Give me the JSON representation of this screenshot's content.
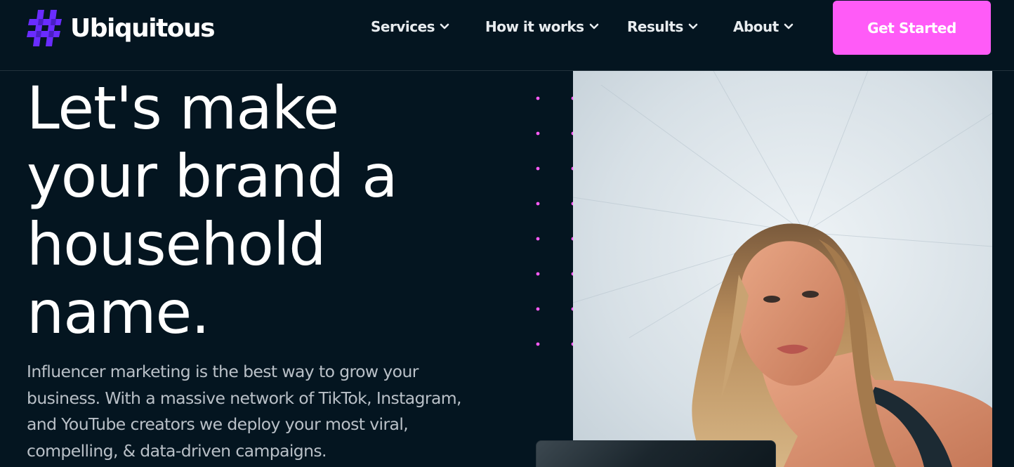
{
  "brand": {
    "name": "Ubiquitous",
    "logo_icon": "hash-icon",
    "accent": "#ff5bf7",
    "logo_color": "#6a2cff"
  },
  "nav": {
    "items": [
      {
        "label": "Services",
        "icon": "chevron-down-icon"
      },
      {
        "label": "How it works",
        "icon": "chevron-down-icon"
      },
      {
        "label": "Results",
        "icon": "chevron-down-icon"
      },
      {
        "label": "About",
        "icon": "chevron-down-icon"
      }
    ],
    "cta_label": "Get Started"
  },
  "hero": {
    "title_lines": [
      "Let's make",
      "your brand a",
      "household",
      "name."
    ],
    "subtitle": "Influencer marketing is the best way to grow your business. With a massive network of TikTok, Instagram, and YouTube creators we deploy your most viral, compelling, & data-driven campaigns."
  },
  "colors": {
    "background": "#041520",
    "dot": "#ff5bf7",
    "photo_bg": "#dfe6ea"
  }
}
